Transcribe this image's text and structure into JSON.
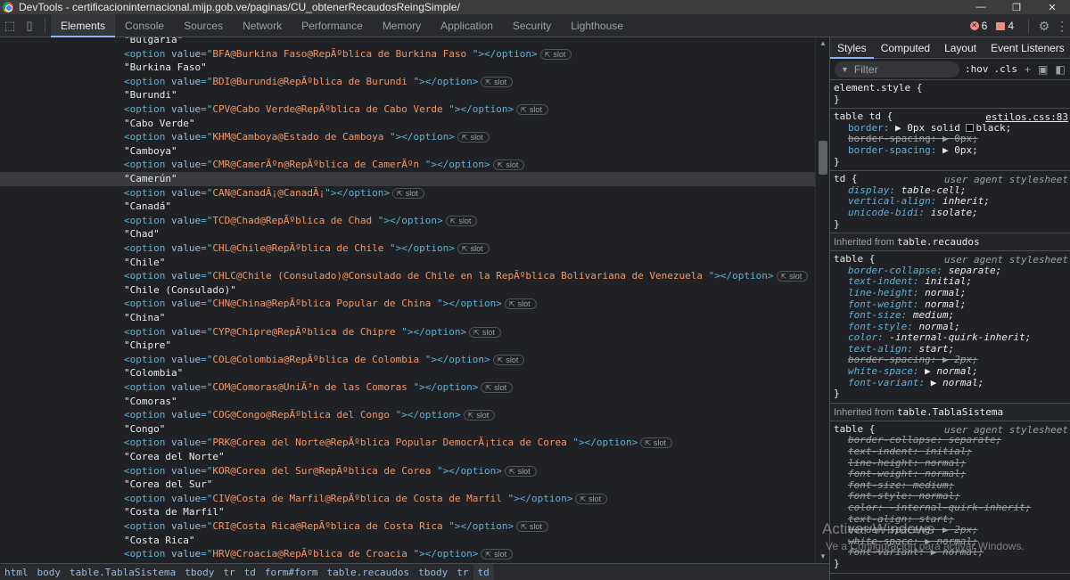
{
  "window": {
    "title": "DevTools - certificacioninternacional.mijp.gob.ve/paginas/CU_obtenerRecaudosReingSimple/",
    "minimize": "—",
    "restore": "❐",
    "close": "✕"
  },
  "toolbar": {
    "tabs": [
      "Elements",
      "Console",
      "Sources",
      "Network",
      "Performance",
      "Memory",
      "Application",
      "Security",
      "Lighthouse"
    ],
    "active_tab": "Elements",
    "errors_count": "6",
    "warnings_count": "4"
  },
  "elements": {
    "lines": [
      {
        "kind": "text",
        "text": "\"Bulgaria\""
      },
      {
        "kind": "option",
        "value": "BFA@Burkina Faso@RepÃºblica de Burkina Faso "
      },
      {
        "kind": "text",
        "text": "\"Burkina Faso\""
      },
      {
        "kind": "option",
        "value": "BDI@Burundi@RepÃºblica de Burundi "
      },
      {
        "kind": "text",
        "text": "\"Burundi\""
      },
      {
        "kind": "option",
        "value": "CPV@Cabo Verde@RepÃºblica de Cabo Verde "
      },
      {
        "kind": "text",
        "text": "\"Cabo Verde\""
      },
      {
        "kind": "option",
        "value": "KHM@Camboya@Estado de Camboya "
      },
      {
        "kind": "text",
        "text": "\"Camboya\""
      },
      {
        "kind": "option",
        "value": "CMR@CamerÃºn@RepÃºblica de CamerÃºn "
      },
      {
        "kind": "text",
        "text": "\"Camerún\"",
        "selected": true
      },
      {
        "kind": "option",
        "value": "CAN@CanadÃ¡@CanadÃ¡"
      },
      {
        "kind": "text",
        "text": "\"Canadá\""
      },
      {
        "kind": "option",
        "value": "TCD@Chad@RepÃºblica de Chad "
      },
      {
        "kind": "text",
        "text": "\"Chad\""
      },
      {
        "kind": "option",
        "value": "CHL@Chile@RepÃºblica de Chile "
      },
      {
        "kind": "text",
        "text": "\"Chile\""
      },
      {
        "kind": "option",
        "value": "CHLC@Chile (Consulado)@Consulado de Chile en la RepÃºblica Bolivariana de Venezuela "
      },
      {
        "kind": "text",
        "text": "\"Chile (Consulado)\""
      },
      {
        "kind": "option",
        "value": "CHN@China@RepÃºblica Popular de China "
      },
      {
        "kind": "text",
        "text": "\"China\""
      },
      {
        "kind": "option",
        "value": "CYP@Chipre@RepÃºblica de Chipre "
      },
      {
        "kind": "text",
        "text": "\"Chipre\""
      },
      {
        "kind": "option",
        "value": "COL@Colombia@RepÃºblica de Colombia "
      },
      {
        "kind": "text",
        "text": "\"Colombia\""
      },
      {
        "kind": "option",
        "value": "COM@Comoras@UniÃ³n de las Comoras "
      },
      {
        "kind": "text",
        "text": "\"Comoras\""
      },
      {
        "kind": "option",
        "value": "COG@Congo@RepÃºblica del Congo "
      },
      {
        "kind": "text",
        "text": "\"Congo\""
      },
      {
        "kind": "option",
        "value": "PRK@Corea del Norte@RepÃºblica Popular DemocrÃ¡tica de Corea "
      },
      {
        "kind": "text",
        "text": "\"Corea del Norte\""
      },
      {
        "kind": "option",
        "value": "KOR@Corea del Sur@RepÃºblica de Corea "
      },
      {
        "kind": "text",
        "text": "\"Corea del Sur\""
      },
      {
        "kind": "option",
        "value": "CIV@Costa de Marfil@RepÃºblica de Costa de Marfil "
      },
      {
        "kind": "text",
        "text": "\"Costa de Marfil\""
      },
      {
        "kind": "option",
        "value": "CRI@Costa Rica@RepÃºblica de Costa Rica "
      },
      {
        "kind": "text",
        "text": "\"Costa Rica\""
      },
      {
        "kind": "option",
        "value": "HRV@Croacia@RepÃºblica de Croacia "
      }
    ],
    "slot_label": "slot"
  },
  "styles": {
    "tabs": [
      "Styles",
      "Computed",
      "Layout",
      "Event Listeners"
    ],
    "more": "»",
    "filter_placeholder": "Filter",
    "hov": ":hov",
    "cls": ".cls",
    "element_style": "element.style {",
    "rule1": {
      "selector": "table td {",
      "source": "estilos.css:83",
      "props": [
        {
          "name": "border",
          "value": "▶ 0px solid ",
          "swatch": true,
          "after": "black;",
          "struck": false
        },
        {
          "name": "border-spacing",
          "value": "▶ 0px;",
          "struck": true
        },
        {
          "name": "border-spacing",
          "value": "▶ 0px;",
          "struck": false
        }
      ]
    },
    "rule2": {
      "selector": "td {",
      "source": "user agent stylesheet",
      "props": [
        {
          "name": "display",
          "value": "table-cell;"
        },
        {
          "name": "vertical-align",
          "value": "inherit;"
        },
        {
          "name": "unicode-bidi",
          "value": "isolate;"
        }
      ]
    },
    "inherited1": {
      "label": "Inherited from",
      "from": "table.recaudos"
    },
    "rule3": {
      "selector": "table {",
      "source": "user agent stylesheet",
      "props": [
        {
          "name": "border-collapse",
          "value": "separate;",
          "struck": false
        },
        {
          "name": "text-indent",
          "value": "initial;",
          "struck": false
        },
        {
          "name": "line-height",
          "value": "normal;",
          "struck": false
        },
        {
          "name": "font-weight",
          "value": "normal;",
          "struck": false
        },
        {
          "name": "font-size",
          "value": "medium;",
          "struck": false
        },
        {
          "name": "font-style",
          "value": "normal;",
          "struck": false
        },
        {
          "name": "color",
          "value": "-internal-quirk-inherit;",
          "struck": false
        },
        {
          "name": "text-align",
          "value": "start;",
          "struck": false
        },
        {
          "name": "border-spacing",
          "value": "▶ 2px;",
          "struck": true
        },
        {
          "name": "white-space",
          "value": "▶ normal;",
          "struck": false
        },
        {
          "name": "font-variant",
          "value": "▶ normal;",
          "struck": false
        }
      ]
    },
    "inherited2": {
      "label": "Inherited from",
      "from": "table.TablaSistema"
    },
    "rule4": {
      "selector": "table {",
      "source": "user agent stylesheet",
      "props": [
        {
          "name": "border-collapse",
          "value": "separate;",
          "struck": true
        },
        {
          "name": "text-indent",
          "value": "initial;",
          "struck": true
        },
        {
          "name": "line-height",
          "value": "normal;",
          "struck": true
        },
        {
          "name": "font-weight",
          "value": "normal;",
          "struck": true
        },
        {
          "name": "font-size",
          "value": "medium;",
          "struck": true
        },
        {
          "name": "font-style",
          "value": "normal;",
          "struck": true
        },
        {
          "name": "color",
          "value": "-internal-quirk-inherit;",
          "struck": true
        },
        {
          "name": "text-align",
          "value": "start;",
          "struck": true
        },
        {
          "name": "border-spacing",
          "value": "▶ 2px;",
          "struck": true
        },
        {
          "name": "white-space",
          "value": "▶ normal;",
          "struck": true
        },
        {
          "name": "font-variant",
          "value": "▶ normal;",
          "struck": true
        }
      ]
    },
    "close_brace": "}"
  },
  "watermark": {
    "line1": "Activar Windows",
    "line2": "Ve a Configuración para activar Windows."
  },
  "breadcrumb": [
    "html",
    "body",
    "table.TablaSistema",
    "tbody",
    "tr",
    "td",
    "form#form",
    "table.recaudos",
    "tbody",
    "tr",
    "td"
  ],
  "colors": {
    "accent": "#8ab4f8",
    "tag": "#5db0d7",
    "attr_value": "#f29766",
    "error": "#f28b82"
  }
}
